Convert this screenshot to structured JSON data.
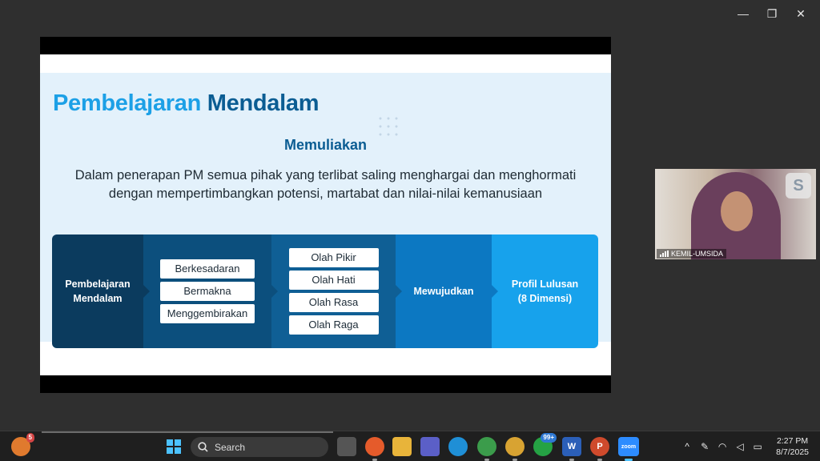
{
  "window": {
    "minimize_icon": "minimize-icon",
    "restore_icon": "restore-icon",
    "close_icon": "close-icon",
    "minimize_glyph": "—",
    "restore_glyph": "❐",
    "close_glyph": "✕"
  },
  "slide": {
    "title_part1": "Pembelajaran",
    "title_part2": "Mendalam",
    "subtitle": "Memuliakan",
    "description_line1": "Dalam penerapan PM semua pihak yang terlibat saling menghargai dan menghormati",
    "description_line2": "dengan mempertimbangkan potensi, martabat dan nilai-nilai kemanusiaan",
    "flow": {
      "step1_line1": "Pembelajaran",
      "step1_line2": "Mendalam",
      "step2_items": [
        "Berkesadaran",
        "Bermakna",
        "Menggembirakan"
      ],
      "step3_items": [
        "Olah Pikir",
        "Olah Hati",
        "Olah Rasa",
        "Olah Raga"
      ],
      "step4": "Mewujudkan",
      "step5_line1": "Profil Lulusan",
      "step5_line2": "(8 Dimensi)"
    },
    "colors": {
      "title_light": "#1ca0e6",
      "title_dark": "#0b5d93",
      "background": "#e3f1fb"
    }
  },
  "video": {
    "participant_name": "KEMIL-UMSIDA",
    "app_icon": "participant-app-icon"
  },
  "taskbar": {
    "start_icon": "windows-start-icon",
    "search_placeholder": "Search",
    "notification_badge": "5",
    "teams_badge": "99+",
    "apps": [
      "task-view",
      "firefox",
      "file-explorer",
      "teams",
      "edge",
      "chrome",
      "chrome-profile",
      "whatsapp",
      "word",
      "powerpoint",
      "zoom"
    ],
    "zoom_label": "zoom",
    "word_glyph": "W",
    "powerpoint_glyph": "P",
    "tray_chevron": "^",
    "time": "2:27 PM",
    "date": "8/7/2025"
  }
}
